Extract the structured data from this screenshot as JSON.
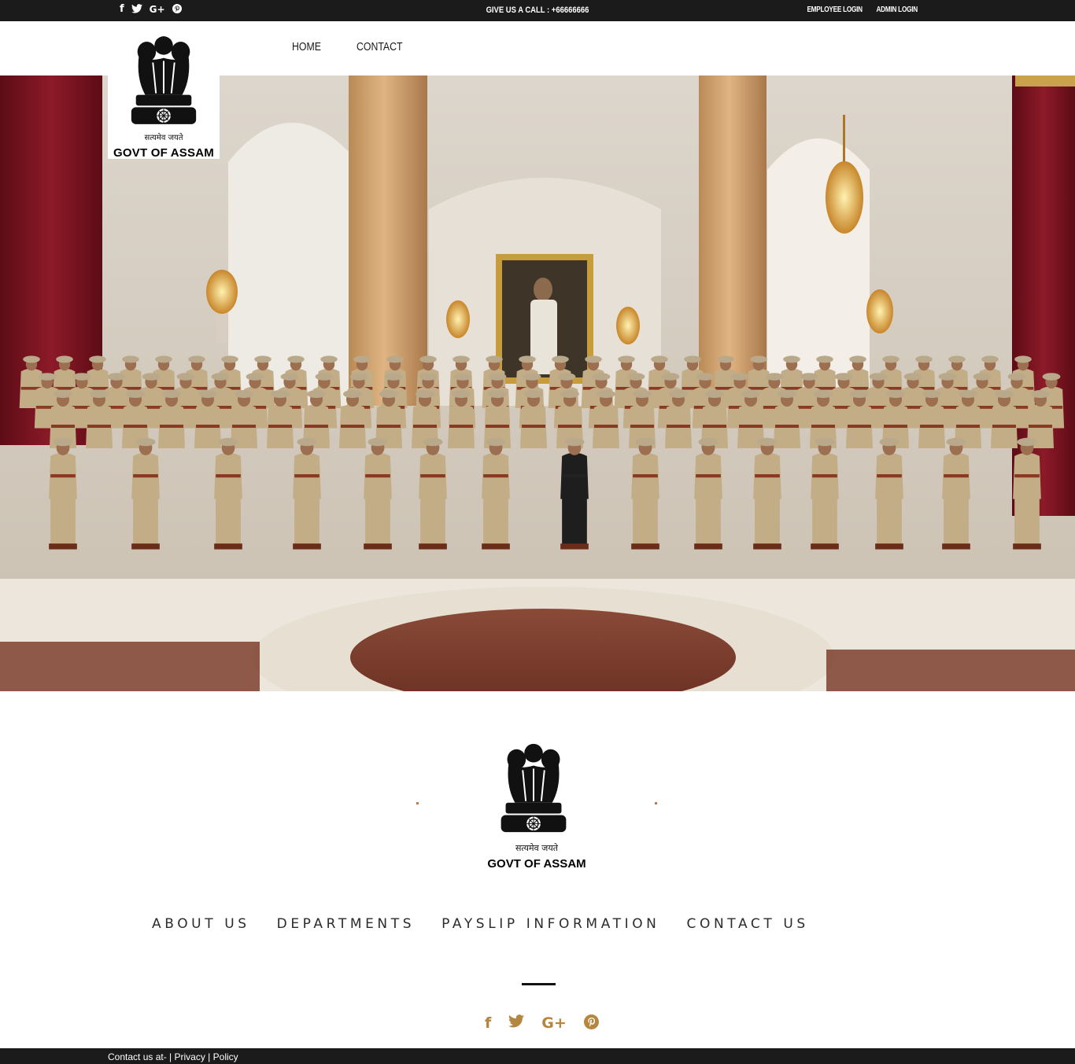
{
  "topbar": {
    "social_icons": [
      {
        "name": "facebook-icon",
        "glyph": "f"
      },
      {
        "name": "twitter-icon",
        "glyph": "🐦"
      },
      {
        "name": "google-plus-icon",
        "glyph": "G+"
      },
      {
        "name": "pinterest-icon",
        "glyph": "℗"
      }
    ],
    "call_text": "GIVE US A CALL : +66666666",
    "employee_login": "EMPLOYEE LOGIN",
    "admin_login": "ADMIN LOGIN"
  },
  "header": {
    "logo": {
      "motto": "सत्यमेव जयते",
      "title": "GOVT OF ASSAM"
    },
    "nav": [
      "HOME",
      "CONTACT"
    ]
  },
  "footer": {
    "logo": {
      "motto": "सत्यमेव जयते",
      "title": "GOVT OF ASSAM"
    },
    "nav": [
      "ABOUT US",
      "DEPARTMENTS",
      "PAYSLIP INFORMATION",
      "CONTACT US"
    ],
    "social_icons": [
      {
        "name": "facebook-icon",
        "glyph": "f"
      },
      {
        "name": "twitter-icon",
        "glyph": "🐦"
      },
      {
        "name": "google-plus-icon",
        "glyph": "G+"
      },
      {
        "name": "pinterest-icon",
        "glyph": "℗"
      }
    ],
    "accent_color": "#b5863f",
    "bottom": {
      "contact": "Contact us at- | ",
      "privacy": "Privacy",
      "sep": " | ",
      "policy": "Policy"
    }
  },
  "colors": {
    "bar_background": "#1b1b1b",
    "curtain": "#7a1220",
    "uniform": "#c2ad86"
  }
}
